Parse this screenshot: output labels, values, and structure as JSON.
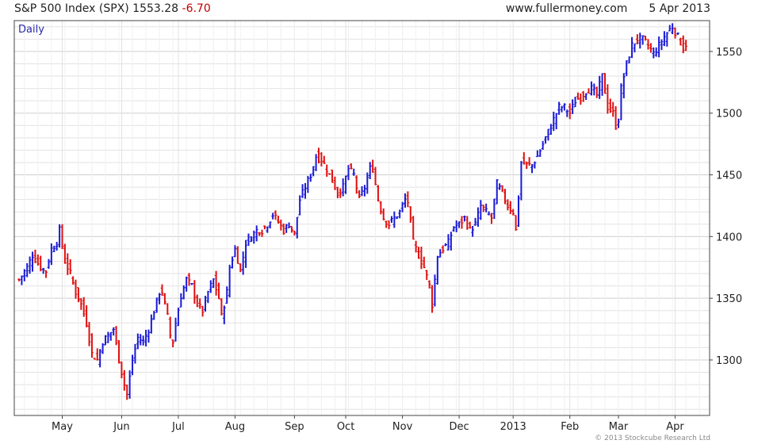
{
  "header": {
    "title": "S&P 500 Index (SPX)",
    "last": "1553.28",
    "change": "-6.70",
    "site": "www.fullermoney.com",
    "date": "5 Apr 2013"
  },
  "copyright": "© 2013 Stockcube Research Ltd",
  "colors": {
    "up": "#1a1ad6",
    "down": "#e01010",
    "grid": "#e2e2e2",
    "axis": "#444444",
    "label": "#2a2aa8"
  },
  "chart_data": {
    "type": "ohlc",
    "label": "Daily",
    "yticks": [
      1300,
      1350,
      1400,
      1450,
      1500,
      1550
    ],
    "ylim": [
      1255,
      1575
    ],
    "xlim": [
      0,
      254
    ],
    "xticks": [
      {
        "label": "May",
        "idx": 16
      },
      {
        "label": "Jun",
        "idx": 38
      },
      {
        "label": "Jul",
        "idx": 59
      },
      {
        "label": "Aug",
        "idx": 80
      },
      {
        "label": "Sep",
        "idx": 102
      },
      {
        "label": "Oct",
        "idx": 121
      },
      {
        "label": "Nov",
        "idx": 142
      },
      {
        "label": "Dec",
        "idx": 163
      },
      {
        "label": "2013",
        "idx": 183
      },
      {
        "label": "Feb",
        "idx": 204
      },
      {
        "label": "Mar",
        "idx": 222
      },
      {
        "label": "Apr",
        "idx": 243
      }
    ],
    "anchors": [
      [
        0,
        1365
      ],
      [
        3,
        1375
      ],
      [
        5,
        1385
      ],
      [
        8,
        1375
      ],
      [
        10,
        1372
      ],
      [
        12,
        1390
      ],
      [
        14,
        1395
      ],
      [
        15,
        1405
      ],
      [
        17,
        1380
      ],
      [
        19,
        1370
      ],
      [
        21,
        1355
      ],
      [
        23,
        1345
      ],
      [
        25,
        1330
      ],
      [
        27,
        1305
      ],
      [
        29,
        1300
      ],
      [
        31,
        1315
      ],
      [
        33,
        1320
      ],
      [
        35,
        1325
      ],
      [
        37,
        1300
      ],
      [
        39,
        1280
      ],
      [
        40,
        1272
      ],
      [
        42,
        1300
      ],
      [
        44,
        1318
      ],
      [
        46,
        1315
      ],
      [
        48,
        1325
      ],
      [
        50,
        1340
      ],
      [
        52,
        1355
      ],
      [
        53,
        1355
      ],
      [
        55,
        1335
      ],
      [
        56,
        1320
      ],
      [
        57,
        1315
      ],
      [
        58,
        1330
      ],
      [
        60,
        1352
      ],
      [
        62,
        1365
      ],
      [
        64,
        1360
      ],
      [
        66,
        1345
      ],
      [
        68,
        1340
      ],
      [
        70,
        1355
      ],
      [
        72,
        1365
      ],
      [
        74,
        1350
      ],
      [
        75,
        1335
      ],
      [
        77,
        1355
      ],
      [
        78,
        1375
      ],
      [
        80,
        1390
      ],
      [
        82,
        1372
      ],
      [
        84,
        1395
      ],
      [
        86,
        1400
      ],
      [
        88,
        1405
      ],
      [
        90,
        1405
      ],
      [
        92,
        1410
      ],
      [
        94,
        1418
      ],
      [
        96,
        1412
      ],
      [
        98,
        1405
      ],
      [
        100,
        1410
      ],
      [
        102,
        1402
      ],
      [
        104,
        1430
      ],
      [
        106,
        1440
      ],
      [
        108,
        1450
      ],
      [
        110,
        1465
      ],
      [
        112,
        1462
      ],
      [
        114,
        1455
      ],
      [
        116,
        1445
      ],
      [
        118,
        1435
      ],
      [
        120,
        1440
      ],
      [
        122,
        1455
      ],
      [
        124,
        1450
      ],
      [
        126,
        1430
      ],
      [
        128,
        1440
      ],
      [
        130,
        1455
      ],
      [
        131,
        1455
      ],
      [
        133,
        1430
      ],
      [
        135,
        1415
      ],
      [
        137,
        1410
      ],
      [
        139,
        1415
      ],
      [
        141,
        1420
      ],
      [
        143,
        1430
      ],
      [
        144,
        1428
      ],
      [
        146,
        1395
      ],
      [
        148,
        1385
      ],
      [
        150,
        1375
      ],
      [
        152,
        1360
      ],
      [
        153,
        1345
      ],
      [
        155,
        1385
      ],
      [
        157,
        1390
      ],
      [
        159,
        1395
      ],
      [
        161,
        1408
      ],
      [
        163,
        1410
      ],
      [
        165,
        1415
      ],
      [
        167,
        1405
      ],
      [
        169,
        1410
      ],
      [
        171,
        1425
      ],
      [
        173,
        1420
      ],
      [
        175,
        1415
      ],
      [
        177,
        1443
      ],
      [
        179,
        1435
      ],
      [
        181,
        1425
      ],
      [
        183,
        1420
      ],
      [
        184,
        1405
      ],
      [
        186,
        1460
      ],
      [
        188,
        1458
      ],
      [
        190,
        1458
      ],
      [
        192,
        1465
      ],
      [
        194,
        1475
      ],
      [
        196,
        1485
      ],
      [
        198,
        1495
      ],
      [
        200,
        1505
      ],
      [
        202,
        1505
      ],
      [
        204,
        1500
      ],
      [
        206,
        1510
      ],
      [
        208,
        1513
      ],
      [
        210,
        1518
      ],
      [
        212,
        1520
      ],
      [
        214,
        1515
      ],
      [
        216,
        1530
      ],
      [
        218,
        1505
      ],
      [
        220,
        1500
      ],
      [
        221,
        1490
      ],
      [
        222,
        1495
      ],
      [
        223,
        1520
      ],
      [
        225,
        1540
      ],
      [
        227,
        1555
      ],
      [
        229,
        1560
      ],
      [
        231,
        1560
      ],
      [
        233,
        1555
      ],
      [
        235,
        1548
      ],
      [
        237,
        1555
      ],
      [
        239,
        1562
      ],
      [
        241,
        1568
      ],
      [
        242,
        1570
      ],
      [
        244,
        1562
      ],
      [
        246,
        1553
      ],
      [
        247,
        1556
      ]
    ]
  }
}
